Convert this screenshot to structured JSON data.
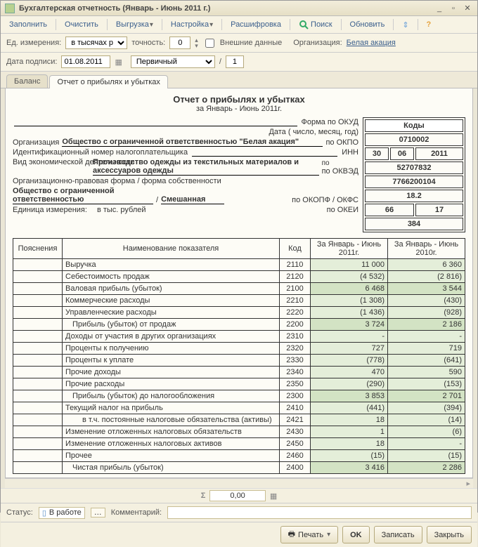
{
  "window": {
    "title": "Бухгалтерская отчетность (Январь - Июнь 2011 г.)"
  },
  "toolbar": {
    "fill": "Заполнить",
    "clear": "Очистить",
    "upload": "Выгрузка",
    "settings": "Настройка",
    "decode": "Расшифровка",
    "search": "Поиск",
    "refresh": "Обновить"
  },
  "params": {
    "unit_label": "Ед. измерения:",
    "unit_value": "в тысячах р",
    "precision_label": "точность:",
    "precision_value": "0",
    "external_label": "Внешние данные",
    "org_label": "Организация:",
    "org_link": "Белая акация",
    "date_sign_label": "Дата подписи:",
    "date_sign_value": "01.08.2011",
    "primary": "Первичный",
    "page_sep": "/",
    "page_num": "1"
  },
  "tabs": {
    "balance": "Баланс",
    "pl": "Отчет о прибылях и убытках"
  },
  "report": {
    "title": "Отчет о прибылях и убытках",
    "period": "за Январь - Июнь 2011г.",
    "codes_header": "Коды",
    "okud_label": "Форма по ОКУД",
    "okud": "0710002",
    "date_label": "Дата ( число, месяц, год)",
    "date_d": "30",
    "date_m": "06",
    "date_y": "2011",
    "org_label": "Организация",
    "org_value": "Общество с ограниченной ответственностью \"Белая акация\"",
    "okpo_label": "по ОКПО",
    "okpo": "52707832",
    "inn_label": "Идентификационный номер налогоплательщика",
    "inn_code_label": "ИНН",
    "inn": "7766200104",
    "activity_label": "Вид экономической деятельности",
    "activity_value": "Производство одежды из текстильных материалов и аксессуаров одежды",
    "okved_label": "по ОКВЭД",
    "okved": "18.2",
    "legal_label": "Организационно-правовая форма / форма собственности",
    "legal_value": "Общество с ограниченной ответственностью",
    "legal_sep": "/",
    "legal_value2": "Смешанная",
    "okopf_label": "по ОКОПФ / ОКФС",
    "okopf1": "66",
    "okopf2": "17",
    "unit_row_label": "Единица измерения:",
    "unit_row_value": "в тыс. рублей",
    "okei_label": "по ОКЕИ",
    "okei": "384",
    "col_explain": "Пояснения",
    "col_indicator": "Наименование показателя",
    "col_code": "Код",
    "col_cur": "За Январь - Июнь 2011г.",
    "col_prev": "За Январь - Июнь 2010г.",
    "rows": [
      {
        "name": "Выручка",
        "code": "2110",
        "cur": "11 000",
        "prev": "6 360",
        "hl": false,
        "indent": 0
      },
      {
        "name": "Себестоимость продаж",
        "code": "2120",
        "cur": "(4 532)",
        "prev": "(2 816)",
        "hl": false,
        "indent": 0
      },
      {
        "name": "Валовая прибыль (убыток)",
        "code": "2100",
        "cur": "6 468",
        "prev": "3 544",
        "hl": true,
        "indent": 0
      },
      {
        "name": "Коммерческие расходы",
        "code": "2210",
        "cur": "(1 308)",
        "prev": "(430)",
        "hl": false,
        "indent": 0
      },
      {
        "name": "Управленческие расходы",
        "code": "2220",
        "cur": "(1 436)",
        "prev": "(928)",
        "hl": false,
        "indent": 0
      },
      {
        "name": "Прибыль (убыток) от продаж",
        "code": "2200",
        "cur": "3 724",
        "prev": "2 186",
        "hl": true,
        "indent": 1
      },
      {
        "name": "Доходы от участия в других организациях",
        "code": "2310",
        "cur": "-",
        "prev": "-",
        "hl": false,
        "indent": 0
      },
      {
        "name": "Проценты к получению",
        "code": "2320",
        "cur": "727",
        "prev": "719",
        "hl": false,
        "indent": 0
      },
      {
        "name": "Проценты к уплате",
        "code": "2330",
        "cur": "(778)",
        "prev": "(641)",
        "hl": false,
        "indent": 0
      },
      {
        "name": "Прочие доходы",
        "code": "2340",
        "cur": "470",
        "prev": "590",
        "hl": false,
        "indent": 0
      },
      {
        "name": "Прочие расходы",
        "code": "2350",
        "cur": "(290)",
        "prev": "(153)",
        "hl": false,
        "indent": 0
      },
      {
        "name": "Прибыль (убыток) до налогообложения",
        "code": "2300",
        "cur": "3 853",
        "prev": "2 701",
        "hl": true,
        "indent": 1
      },
      {
        "name": "Текущий налог на прибыль",
        "code": "2410",
        "cur": "(441)",
        "prev": "(394)",
        "hl": false,
        "indent": 0
      },
      {
        "name": "в т.ч. постоянные налоговые обязательства (активы)",
        "code": "2421",
        "cur": "18",
        "prev": "(14)",
        "hl": false,
        "indent": 2
      },
      {
        "name": "Изменение отложенных налоговых обязательств",
        "code": "2430",
        "cur": "1",
        "prev": "(6)",
        "hl": false,
        "indent": 0
      },
      {
        "name": "Изменение отложенных налоговых активов",
        "code": "2450",
        "cur": "18",
        "prev": "-",
        "hl": false,
        "indent": 0
      },
      {
        "name": "Прочее",
        "code": "2460",
        "cur": "(15)",
        "prev": "(15)",
        "hl": false,
        "indent": 0
      },
      {
        "name": "Чистая прибыль (убыток)",
        "code": "2400",
        "cur": "3 416",
        "prev": "2 286",
        "hl": true,
        "indent": 1
      }
    ]
  },
  "sumbar": {
    "value": "0,00"
  },
  "status": {
    "label": "Статус:",
    "value": "В работе",
    "comment_label": "Комментарий:"
  },
  "bottom": {
    "print": "Печать",
    "ok": "OK",
    "save": "Записать",
    "close": "Закрыть"
  }
}
